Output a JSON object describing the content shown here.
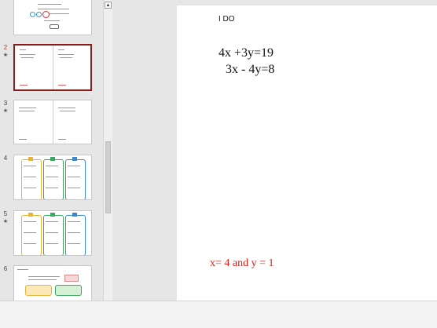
{
  "thumbnails": [
    {
      "number": "",
      "starred": false
    },
    {
      "number": "2",
      "starred": true,
      "selected": true
    },
    {
      "number": "3",
      "starred": true
    },
    {
      "number": "4",
      "starred": false
    },
    {
      "number": "5",
      "starred": true
    },
    {
      "number": "6",
      "starred": false
    }
  ],
  "star_glyph": "★",
  "scroll_up_glyph": "▲",
  "slide": {
    "title": "I DO",
    "eq1": "4x +3y=19",
    "eq2": "3x - 4y=8",
    "answer": "x= 4 and y = 1"
  },
  "colors": {
    "answer": "#e0201b",
    "selected_border": "#8b1a1a"
  }
}
